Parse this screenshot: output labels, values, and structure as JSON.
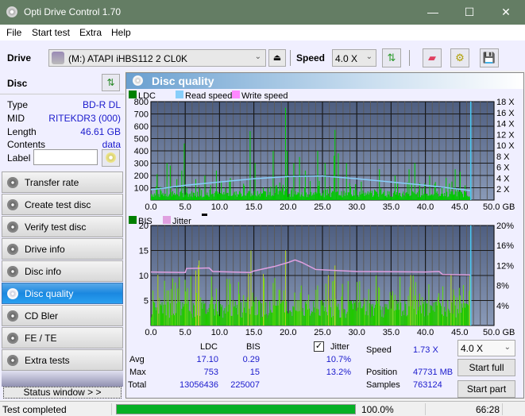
{
  "window": {
    "title": "Opti Drive Control 1.70",
    "minimize_icon": "minimize-icon",
    "maximize_icon": "maximize-icon",
    "close_icon": "close-icon"
  },
  "menu": [
    {
      "label": "File",
      "mnemonic": "F"
    },
    {
      "label": "Start test",
      "mnemonic": "S"
    },
    {
      "label": "Extra",
      "mnemonic": "x"
    },
    {
      "label": "Help",
      "mnemonic": "H"
    }
  ],
  "toolbar": {
    "drive_label": "Drive",
    "drive_value": "(M:)  ATAPI iHBS112  2 CL0K",
    "speed_label": "Speed",
    "speed_value": "4.0 X",
    "eject_icon": "eject-icon",
    "refresh_icon": "refresh-icon",
    "erase_icon": "eraser-icon",
    "settings_icon": "settings-icon",
    "save_icon": "save-icon"
  },
  "disc": {
    "header": "Disc",
    "rows": [
      {
        "key": "Type",
        "value": "BD-R DL"
      },
      {
        "key": "MID",
        "value": "RITEKDR3 (000)"
      },
      {
        "key": "Length",
        "value": "46.61 GB"
      },
      {
        "key": "Contents",
        "value": "data"
      }
    ],
    "label_key": "Label",
    "label_value": ""
  },
  "nav": [
    {
      "label": "Transfer rate",
      "active": false
    },
    {
      "label": "Create test disc",
      "active": false
    },
    {
      "label": "Verify test disc",
      "active": false
    },
    {
      "label": "Drive info",
      "active": false
    },
    {
      "label": "Disc info",
      "active": false
    },
    {
      "label": "Disc quality",
      "active": true
    },
    {
      "label": "CD Bler",
      "active": false
    },
    {
      "label": "FE / TE",
      "active": false
    },
    {
      "label": "Extra tests",
      "active": false
    }
  ],
  "status_window_button": "Status window > >",
  "panel": {
    "title": "Disc quality"
  },
  "chart_data": [
    {
      "type": "bar",
      "title": "LDC",
      "legend": [
        "LDC",
        "Read speed",
        "Write speed"
      ],
      "legend_colors": [
        "#008000",
        "#87cefa",
        "#ff88ff"
      ],
      "x_ticks": [
        "0.0",
        "5.0",
        "10.0",
        "15.0",
        "20.0",
        "25.0",
        "30.0",
        "35.0",
        "40.0",
        "45.0",
        "50.0 GB"
      ],
      "xlim": [
        0,
        50
      ],
      "ylim": [
        0,
        800
      ],
      "y_ticks": [
        "100",
        "200",
        "300",
        "400",
        "500",
        "600",
        "700",
        "800"
      ],
      "y2_ticks": [
        "2 X",
        "4 X",
        "6 X",
        "8 X",
        "10 X",
        "12 X",
        "14 X",
        "16 X",
        "18 X"
      ],
      "y2lim": [
        0,
        18
      ],
      "disc_end_gb": 46.61,
      "ldc_peaks": [
        [
          0.3,
          380
        ],
        [
          0.8,
          210
        ],
        [
          2.3,
          300
        ],
        [
          2.8,
          280
        ],
        [
          3.7,
          170
        ],
        [
          4.8,
          460
        ],
        [
          4.4,
          240
        ],
        [
          6.5,
          170
        ],
        [
          7.8,
          200
        ],
        [
          9.5,
          240
        ],
        [
          11.5,
          180
        ],
        [
          14.4,
          560
        ],
        [
          15.1,
          300
        ],
        [
          17.8,
          400
        ],
        [
          19.6,
          750
        ],
        [
          19.8,
          400
        ],
        [
          20.7,
          300
        ],
        [
          21.6,
          350
        ],
        [
          22.4,
          240
        ],
        [
          24.3,
          400
        ],
        [
          25.3,
          300
        ],
        [
          26.6,
          360
        ],
        [
          26.8,
          570
        ],
        [
          27.2,
          380
        ],
        [
          28.5,
          300
        ],
        [
          33.2,
          250
        ],
        [
          35.5,
          200
        ],
        [
          37.5,
          250
        ],
        [
          38.4,
          300
        ],
        [
          40.6,
          200
        ],
        [
          43.0,
          180
        ],
        [
          44.3,
          250
        ],
        [
          45.0,
          230
        ]
      ],
      "ldc_base": 45,
      "read_speed": [
        [
          0,
          1.9
        ],
        [
          2,
          2.2
        ],
        [
          5,
          2.7
        ],
        [
          10,
          3.3
        ],
        [
          15,
          3.9
        ],
        [
          20,
          4.3
        ],
        [
          25,
          4.4
        ],
        [
          30,
          3.9
        ],
        [
          35,
          3.3
        ],
        [
          40,
          2.7
        ],
        [
          45,
          2.0
        ],
        [
          46.61,
          1.73
        ]
      ]
    },
    {
      "type": "bar",
      "title": "BIS",
      "legend": [
        "BIS",
        "Jitter"
      ],
      "legend_colors": [
        "#008000",
        "#e0a0e0"
      ],
      "x_ticks": [
        "0.0",
        "5.0",
        "10.0",
        "15.0",
        "20.0",
        "25.0",
        "30.0",
        "35.0",
        "40.0",
        "45.0",
        "50.0 GB"
      ],
      "xlim": [
        0,
        50
      ],
      "ylim": [
        0,
        20
      ],
      "y_ticks": [
        "5",
        "10",
        "15",
        "20"
      ],
      "y2_ticks": [
        "4%",
        "8%",
        "12%",
        "16%",
        "20%"
      ],
      "y2lim": [
        0,
        20
      ],
      "bis_peaks": [
        [
          0.2,
          7
        ],
        [
          2.3,
          7
        ],
        [
          5.3,
          7.5
        ],
        [
          6.5,
          11
        ],
        [
          6.8,
          12
        ],
        [
          7.0,
          13
        ],
        [
          14.5,
          15
        ],
        [
          19.6,
          15
        ],
        [
          21.8,
          8
        ],
        [
          24.3,
          8
        ],
        [
          26.8,
          12
        ],
        [
          26.6,
          9
        ],
        [
          31.5,
          5
        ],
        [
          35.0,
          6
        ],
        [
          38.4,
          6
        ],
        [
          40.0,
          5
        ],
        [
          44.2,
          6
        ],
        [
          45.0,
          6
        ]
      ],
      "bis_base": 3,
      "jitter": [
        [
          0,
          10.7
        ],
        [
          5,
          10.6
        ],
        [
          5.2,
          11.4
        ],
        [
          8.5,
          11.5
        ],
        [
          9,
          10.8
        ],
        [
          14.5,
          10.6
        ],
        [
          15,
          10.9
        ],
        [
          18,
          11.8
        ],
        [
          20,
          12.6
        ],
        [
          21,
          13.1
        ],
        [
          22,
          12.6
        ],
        [
          24,
          11.2
        ],
        [
          30,
          10.8
        ],
        [
          40,
          10.7
        ],
        [
          42,
          10.8
        ],
        [
          42.5,
          10.2
        ],
        [
          46.61,
          10.1
        ]
      ]
    }
  ],
  "stats": {
    "col_ldc": "LDC",
    "col_bis": "BIS",
    "jitter_label": "Jitter",
    "jitter_checked": true,
    "rows": [
      {
        "label": "Avg",
        "ldc": "17.10",
        "bis": "0.29",
        "jitter": "10.7%"
      },
      {
        "label": "Max",
        "ldc": "753",
        "bis": "15",
        "jitter": "13.2%"
      },
      {
        "label": "Total",
        "ldc": "13056436",
        "bis": "225007",
        "jitter": ""
      }
    ],
    "speed_label": "Speed",
    "speed_value": "1.73 X",
    "position_label": "Position",
    "position_value": "47731 MB",
    "samples_label": "Samples",
    "samples_value": "763124",
    "speed_select": "4.0 X",
    "start_full": "Start full",
    "start_part": "Start part"
  },
  "statusbar": {
    "text": "Test completed",
    "progress_percent": 100,
    "progress_label": "100.0%",
    "elapsed": "66:28"
  }
}
